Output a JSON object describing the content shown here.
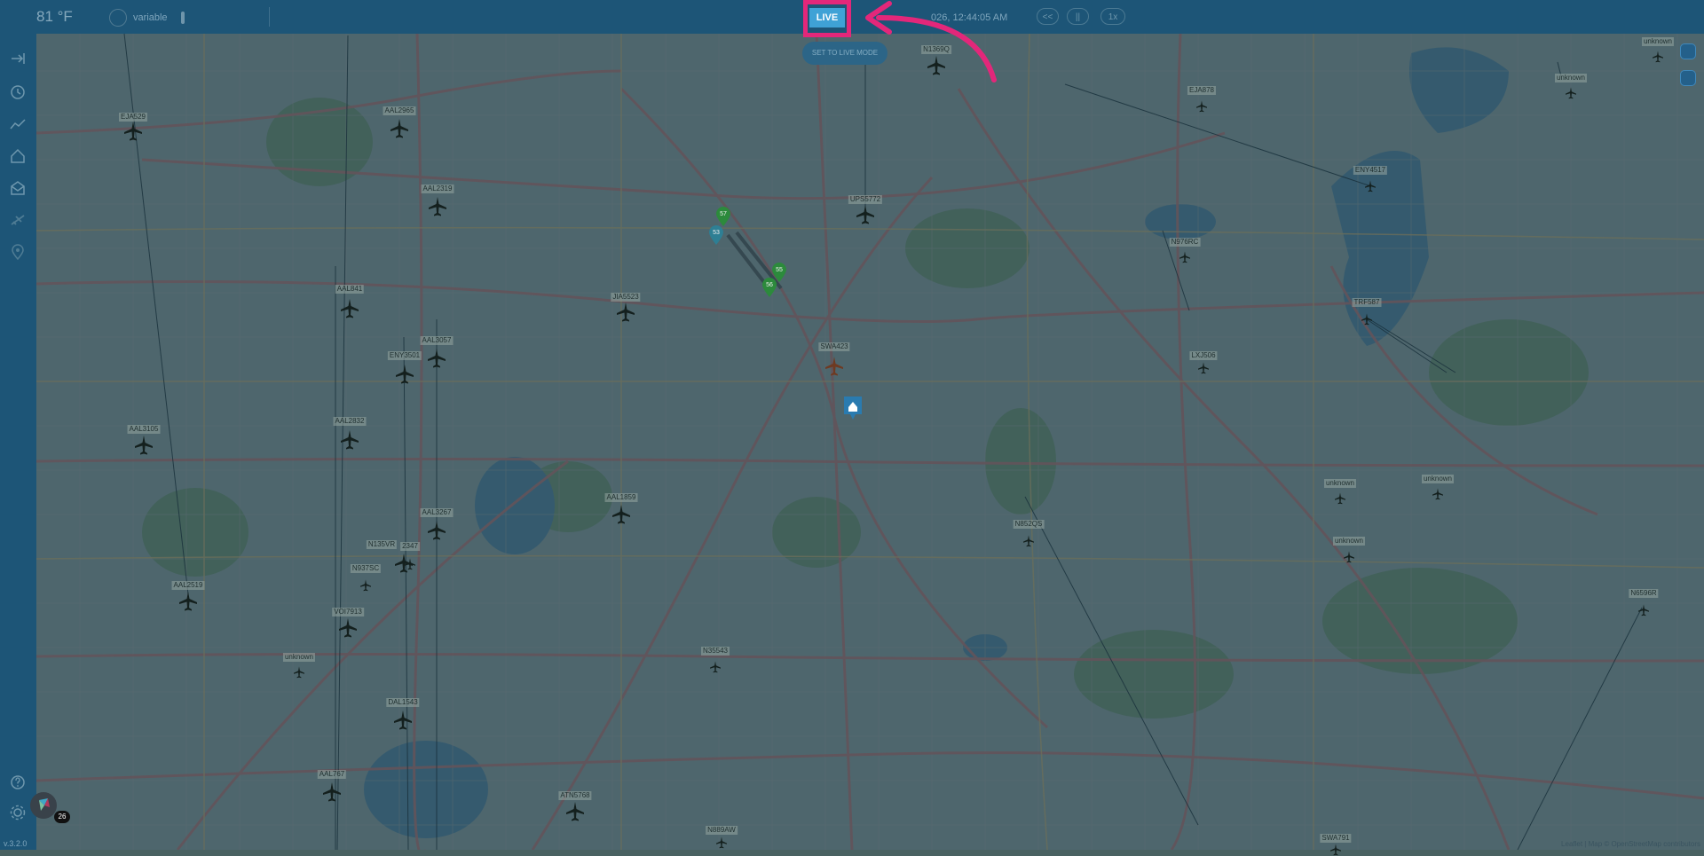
{
  "topbar": {
    "temperature": "81 °F",
    "wind": "variable",
    "datetime": "026, 12:44:05 AM",
    "controls": {
      "rewind": "<<",
      "pause": "||",
      "speed": "1x"
    },
    "live_button": "LIVE",
    "set_live_mode": "SET TO LIVE MODE"
  },
  "sidebar": {
    "icons": [
      "sidebar-collapse-icon",
      "clock-icon",
      "chart-icon",
      "home-icon",
      "inbox-icon",
      "airplane-icon",
      "location-pin-icon"
    ],
    "help_icon": "question-icon",
    "settings_icon": "gear-icon",
    "notification_count": "26",
    "version": "v.3.2.0"
  },
  "map": {
    "attribution": "Leaflet | Map © OpenStreetMap contributors",
    "home_marker_icon": "home-icon",
    "gate_markers": [
      "57",
      "53",
      "55",
      "56"
    ],
    "flights": [
      {
        "id": "EJA529"
      },
      {
        "id": "AAL2965"
      },
      {
        "id": "AAL2319"
      },
      {
        "id": "AAL841"
      },
      {
        "id": "AAL3057"
      },
      {
        "id": "ENY3501"
      },
      {
        "id": "AAL3105"
      },
      {
        "id": "AAL2832"
      },
      {
        "id": "AAL3267"
      },
      {
        "id": "N135VR"
      },
      {
        "id": "2347"
      },
      {
        "id": "N937SC"
      },
      {
        "id": "AAL2519"
      },
      {
        "id": "VOI7913"
      },
      {
        "id": "unknown"
      },
      {
        "id": "DAL1543"
      },
      {
        "id": "AAL767"
      },
      {
        "id": "ATN5768"
      },
      {
        "id": "N889AW"
      },
      {
        "id": "N35543"
      },
      {
        "id": "AAL1859"
      },
      {
        "id": "JIA5523"
      },
      {
        "id": "SWA423"
      },
      {
        "id": "UPS5772"
      },
      {
        "id": "N1369Q"
      },
      {
        "id": "EJA878"
      },
      {
        "id": "N976RC"
      },
      {
        "id": "LXJ506"
      },
      {
        "id": "N852QS"
      },
      {
        "id": "ENY4517"
      },
      {
        "id": "TRF587"
      },
      {
        "id": "unknown"
      },
      {
        "id": "unknown"
      },
      {
        "id": "unknown"
      },
      {
        "id": "unknown"
      },
      {
        "id": "N6596R"
      },
      {
        "id": "SWA791"
      },
      {
        "id": "unknown"
      }
    ]
  }
}
